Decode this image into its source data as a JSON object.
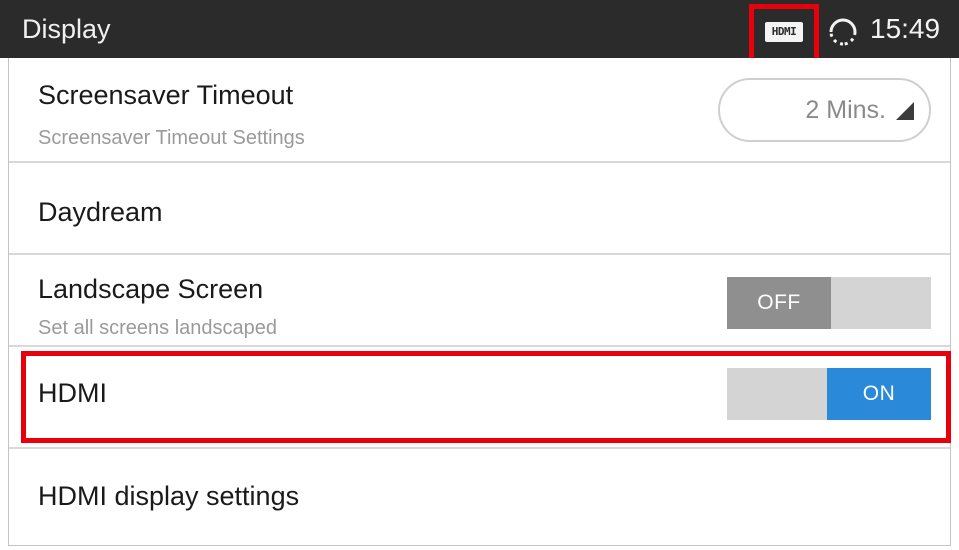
{
  "status_bar": {
    "title": "Display",
    "hdmi_icon_label": "HDMI",
    "sync_icon": "sync-icon",
    "time": "15:49"
  },
  "settings": {
    "screensaver_timeout": {
      "title": "Screensaver Timeout",
      "subtitle": "Screensaver Timeout Settings",
      "value": "2 Mins."
    },
    "daydream": {
      "title": "Daydream"
    },
    "landscape_screen": {
      "title": "Landscape Screen",
      "subtitle": "Set all screens landscaped",
      "toggle_label": "OFF",
      "state": false
    },
    "hdmi": {
      "title": "HDMI",
      "toggle_label": "ON",
      "state": true
    },
    "hdmi_display_settings": {
      "title": "HDMI display settings"
    }
  },
  "colors": {
    "status_bar_bg": "#2b2b2b",
    "toggle_on": "#2a8ad9",
    "toggle_off": "#8f8f8f",
    "highlight": "#e8000b"
  }
}
